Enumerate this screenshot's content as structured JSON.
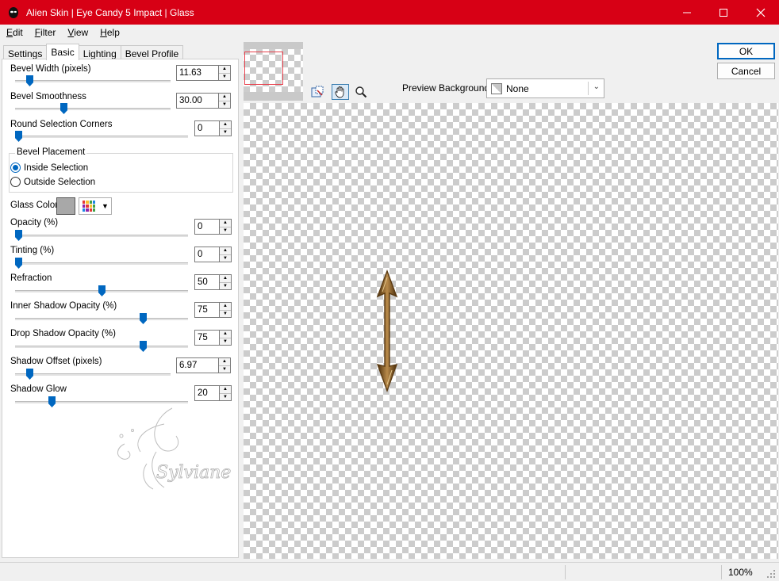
{
  "window": {
    "title": "Alien Skin | Eye Candy 5 Impact | Glass",
    "minimize_glyph": "—",
    "maximize_glyph": "☐",
    "close_glyph": "✕",
    "accent_color": "#d70015"
  },
  "menubar": {
    "items": [
      {
        "key": "E",
        "rest": "dit"
      },
      {
        "key": "F",
        "rest": "ilter"
      },
      {
        "key": "V",
        "rest": "iew"
      },
      {
        "key": "H",
        "rest": "elp"
      }
    ]
  },
  "tabs": [
    "Settings",
    "Basic",
    "Lighting",
    "Bevel Profile"
  ],
  "active_tab": "Basic",
  "params": {
    "bevel_width": {
      "label": "Bevel Width (pixels)",
      "value": "11.63",
      "slider": 0.08
    },
    "bevel_smoothness": {
      "label": "Bevel Smoothness",
      "value": "30.00",
      "slider": 0.3
    },
    "round_corners": {
      "label": "Round Selection Corners",
      "value": "0",
      "slider": 0.0
    },
    "opacity": {
      "label": "Opacity (%)",
      "value": "0",
      "slider": 0.0
    },
    "tinting": {
      "label": "Tinting (%)",
      "value": "0",
      "slider": 0.0
    },
    "refraction": {
      "label": "Refraction",
      "value": "50",
      "slider": 0.5
    },
    "inner_shadow": {
      "label": "Inner Shadow Opacity (%)",
      "value": "75",
      "slider": 0.75
    },
    "drop_shadow": {
      "label": "Drop Shadow Opacity (%)",
      "value": "75",
      "slider": 0.75
    },
    "shadow_offset": {
      "label": "Shadow Offset (pixels)",
      "value": "6.97",
      "slider": 0.08
    },
    "shadow_glow": {
      "label": "Shadow Glow",
      "value": "20",
      "slider": 0.2
    }
  },
  "bevel_placement": {
    "title": "Bevel Placement",
    "options": [
      "Inside Selection",
      "Outside Selection"
    ],
    "selected": "Inside Selection"
  },
  "glass_color": {
    "label": "Glass Color",
    "color": "#a8a8a8"
  },
  "watermark": "Sylviane",
  "preview_background": {
    "label": "Preview Background:",
    "value": "None"
  },
  "buttons": {
    "ok": "OK",
    "cancel": "Cancel"
  },
  "status": {
    "zoom": "100%"
  },
  "preview_object": {
    "type": "double-headed-arrow",
    "color": "#7a5020"
  }
}
